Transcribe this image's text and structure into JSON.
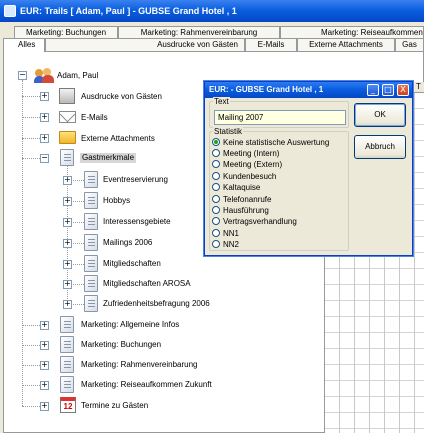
{
  "window": {
    "title": "EUR:  Trails [ Adam, Paul ]  - GUBSE Grand Hotel , 1"
  },
  "tabs": {
    "row1": [
      "Marketing: Buchungen",
      "Marketing: Rahmenvereinbarung",
      "Marketing: Reiseaufkommen"
    ],
    "row2": [
      "Alles",
      "Ausdrucke von Gästen",
      "E-Mails",
      "Externe Attachments",
      "Gas"
    ]
  },
  "tree": {
    "root": "Adam, Paul",
    "ausdrucke": "Ausdrucke von Gästen",
    "emails": "E-Mails",
    "attachments": "Externe Attachments",
    "gastmerkmale": "Gastmerkmale",
    "gastmerkmale_children": [
      "Eventreservierung",
      "Hobbys",
      "Interessensgebiete",
      "Mailings 2006",
      "Mitgliedschaften",
      "Mitgliedschaften AROSA",
      "Zufriedenheitsbefragung 2006"
    ],
    "mkt_infos": "Marketing: Allgemeine Infos",
    "mkt_buchungen": "Marketing: Buchungen",
    "mkt_rahmen": "Marketing: Rahmenvereinbarung",
    "mkt_reise": "Marketing: Reiseaufkommen Zukunft",
    "termine": "Termine zu Gästen",
    "calendar_day": "12"
  },
  "dialog": {
    "title": "EUR:  - GUBSE Grand Hotel , 1",
    "text_group": "Text",
    "text_value": "Mailing 2007",
    "statistik_group": "Statistik",
    "options": [
      "Keine statistische Auswertung",
      "Meeting (Intern)",
      "Meeting (Extern)",
      "Kundenbesuch",
      "Kaltaquise",
      "Telefonanrufe",
      "Hausführung",
      "Vertragsverhandlung",
      "NN1",
      "NN2"
    ],
    "selected_index": 0,
    "ok_label": "OK",
    "cancel_label": "Abbruch",
    "min_glyph": "_",
    "max_glyph": "□",
    "close_glyph": "X"
  },
  "grid": {
    "header_glyph": "T"
  }
}
